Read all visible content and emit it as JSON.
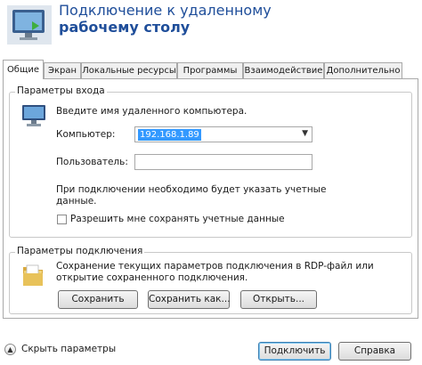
{
  "window": {
    "title_line1": "Подключение к удаленному",
    "title_line2": "рабочему столу"
  },
  "tabs": [
    {
      "label": "Общие",
      "active": true
    },
    {
      "label": "Экран",
      "active": false
    },
    {
      "label": "Локальные ресурсы",
      "active": false
    },
    {
      "label": "Программы",
      "active": false
    },
    {
      "label": "Взаимодействие",
      "active": false
    },
    {
      "label": "Дополнительно",
      "active": false
    }
  ],
  "logon": {
    "legend": "Параметры входа",
    "instruction": "Введите имя удаленного компьютера.",
    "computer_label": "Компьютер:",
    "computer_value": "192.168.1.89",
    "user_label": "Пользователь:",
    "user_value": "",
    "note_line1": "При подключении необходимо будет указать учетные",
    "note_line2": "данные.",
    "save_credentials_label": "Разрешить мне сохранять учетные данные",
    "save_credentials_checked": false
  },
  "connection": {
    "legend": "Параметры подключения",
    "desc_line1": "Сохранение текущих параметров подключения в RDP-файл или",
    "desc_line2": "открытие сохраненного подключения.",
    "save_button": "Сохранить",
    "save_as_button": "Сохранить как...",
    "open_button": "Открыть..."
  },
  "footer": {
    "hide_options": "Скрыть параметры",
    "connect_button": "Подключить",
    "help_button": "Справка"
  },
  "colors": {
    "title_blue": "#1f4e9a",
    "selection": "#3399ff",
    "folder": "#e8c25a"
  }
}
